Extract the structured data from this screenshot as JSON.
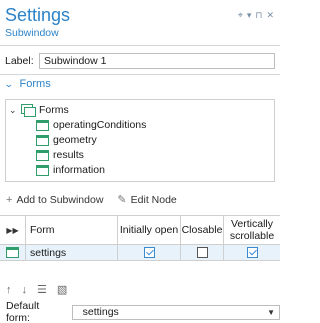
{
  "header": {
    "title": "Settings",
    "subtitle": "Subwindow",
    "tool_icons": [
      "pin-icon",
      "dropdown-icon",
      "pushpin-icon",
      "close-icon"
    ]
  },
  "label_field": {
    "label": "Label:",
    "value": "Subwindow 1"
  },
  "forms_section": {
    "title": "Forms",
    "tree": {
      "root": "Forms",
      "children": [
        "operatingConditions",
        "geometry",
        "results",
        "information"
      ]
    }
  },
  "toolbar": {
    "add_label": "Add to Subwindow",
    "edit_label": "Edit Node"
  },
  "table": {
    "columns": [
      "Form",
      "Initially open",
      "Closable",
      "Vertically scrollable"
    ],
    "rows": [
      {
        "form": "settings",
        "initially_open": true,
        "closable": false,
        "vertically_scrollable": true
      }
    ]
  },
  "move_buttons": [
    "move-up-icon",
    "move-down-icon",
    "list-icon",
    "clear-icon"
  ],
  "default_form": {
    "label": "Default form:",
    "value": "settings"
  },
  "colors": {
    "accent": "#2b83c9",
    "node_icon": "#2f9e6b"
  }
}
